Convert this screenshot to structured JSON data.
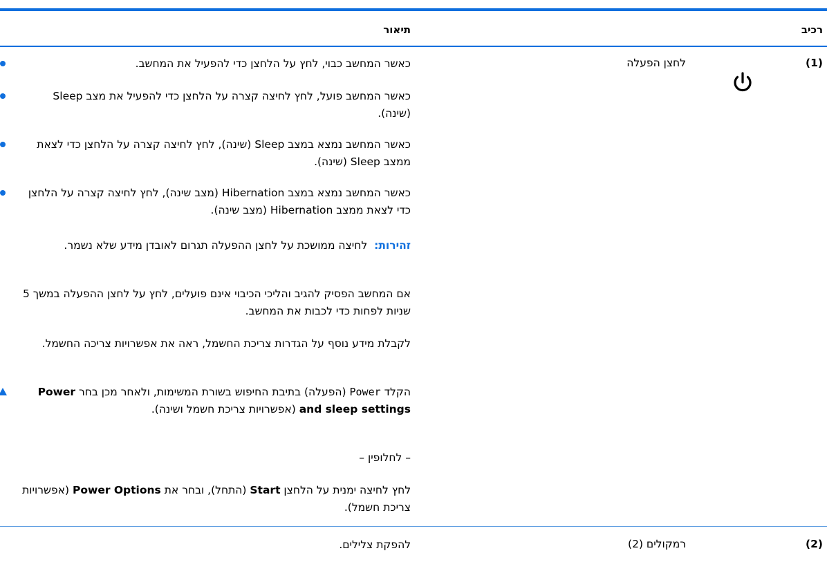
{
  "colors": {
    "accent": "#0f6fde"
  },
  "header": {
    "component": "רכיב",
    "description": "תיאור"
  },
  "rows": [
    {
      "number": "(1)",
      "name": "לחצן הפעלה",
      "icon": "power-icon",
      "bullets": [
        "כאשר המחשב כבוי, לחץ על הלחצן כדי להפעיל את המחשב.",
        "כאשר המחשב פועל, לחץ לחיצה קצרה על הלחצן כדי להפעיל את מצב Sleep (שינה).",
        "כאשר המחשב נמצא במצב Sleep (שינה), לחץ לחיצה קצרה על הלחצן כדי לצאת ממצב Sleep (שינה).",
        "כאשר המחשב נמצא במצב Hibernation (מצב שינה), לחץ לחיצה קצרה על הלחצן כדי לצאת ממצב Hibernation (מצב שינה)."
      ],
      "warning_label": "זהירות:",
      "warning_text": "לחיצה ממושכת על לחצן ההפעלה תגרום לאובדן מידע שלא נשמר.",
      "para1": "אם המחשב הפסיק להגיב והליכי הכיבוי אינם פועלים, לחץ על לחצן ההפעלה במשך 5 שניות לפחות כדי לכבות את המחשב.",
      "para2": "לקבלת מידע נוסף על הגדרות צריכת החשמל, ראה את אפשרויות צריכה החשמל.",
      "step": {
        "p1": "הקלד",
        "code": "Power",
        "p2": "(הפעלה) בתיבת החיפוש בשורת המשימות, ולאחר מכן בחר",
        "bold": "Power and sleep settings",
        "p3": "(אפשרויות צריכת חשמל ושינה)."
      },
      "alt": "– לחלופין –",
      "alt_step": {
        "p1": "לחץ לחיצה ימנית על הלחצן",
        "b1": "Start",
        "p2": "(התחל), ובחר את",
        "b2": "Power Options",
        "p3": "(אפשרויות צריכת חשמל)."
      }
    },
    {
      "number": "(2)",
      "name": "רמקולים (2)",
      "description": "להפקת צלילים."
    }
  ]
}
